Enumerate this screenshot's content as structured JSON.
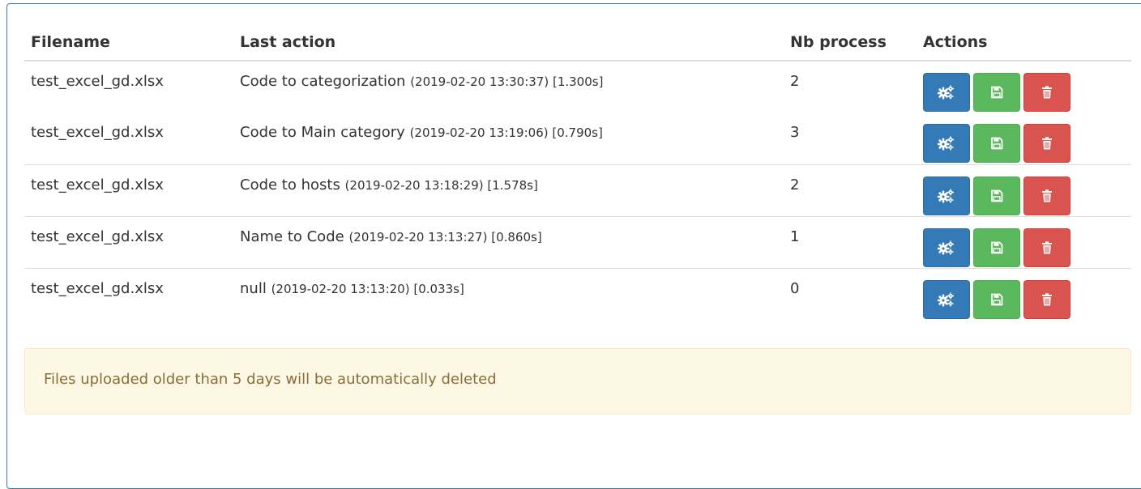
{
  "table": {
    "headers": {
      "filename": "Filename",
      "last_action": "Last action",
      "nb_process": "Nb process",
      "actions": "Actions"
    },
    "rows": [
      {
        "filename": "test_excel_gd.xlsx",
        "action": "Code to categorization",
        "meta": "(2019-02-20 13:30:37) [1.300s]",
        "nb_process": "2"
      },
      {
        "filename": "test_excel_gd.xlsx",
        "action": "Code to Main category",
        "meta": "(2019-02-20 13:19:06) [0.790s]",
        "nb_process": "3"
      },
      {
        "filename": "test_excel_gd.xlsx",
        "action": "Code to hosts",
        "meta": "(2019-02-20 13:18:29) [1.578s]",
        "nb_process": "2"
      },
      {
        "filename": "test_excel_gd.xlsx",
        "action": "Name to Code",
        "meta": "(2019-02-20 13:13:27) [0.860s]",
        "nb_process": "1"
      },
      {
        "filename": "test_excel_gd.xlsx",
        "action": "null",
        "meta": "(2019-02-20 13:13:20) [0.033s]",
        "nb_process": "0"
      }
    ]
  },
  "row_buttons": [
    {
      "icon": "cogs-icon",
      "color": "#337ab7"
    },
    {
      "icon": "save-icon",
      "color": "#5cb85c"
    },
    {
      "icon": "trash-icon",
      "color": "#d9534f"
    }
  ],
  "alert": {
    "text": "Files uploaded older than 5 days will be automatically deleted"
  }
}
